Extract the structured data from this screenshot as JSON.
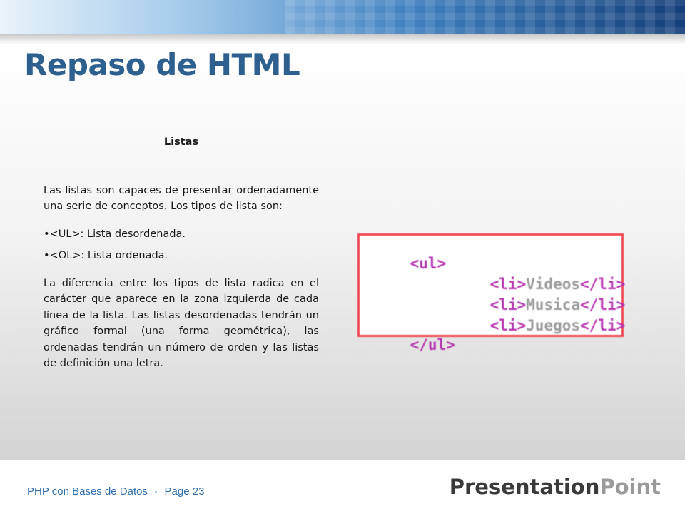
{
  "slide": {
    "title": "Repaso de HTML",
    "subtitle": "Listas",
    "paragraph1": "Las listas son capaces de presentar ordenadamente una serie de conceptos. Los tipos de lista son:",
    "bullets": [
      "•<UL>: Lista desordenada.",
      "•<OL>: Lista ordenada."
    ],
    "paragraph2": "La diferencia entre los tipos de lista radica en el carácter que aparece en la zona izquierda de cada línea de la lista. Las listas desordenadas tendrán un gráfico formal (una forma geométrica), las ordenadas tendrán un número de orden y las listas de definición una letra."
  },
  "code_example": {
    "open_tag": "<ul>",
    "li_open": "<li>",
    "li_close": "</li>",
    "items": [
      "Videos",
      "Musica",
      "Juegos"
    ],
    "close_tag": "</ul>",
    "border_color": "#f1464f",
    "tag_color": "#b533b0"
  },
  "footer": {
    "course": "PHP con Bases de Datos",
    "separator": "▫",
    "page": "Page 23",
    "brand_part1": "Presentation",
    "brand_part2": "Point"
  },
  "colors": {
    "title": "#2d5f8f",
    "footer_text": "#2f6fad"
  }
}
